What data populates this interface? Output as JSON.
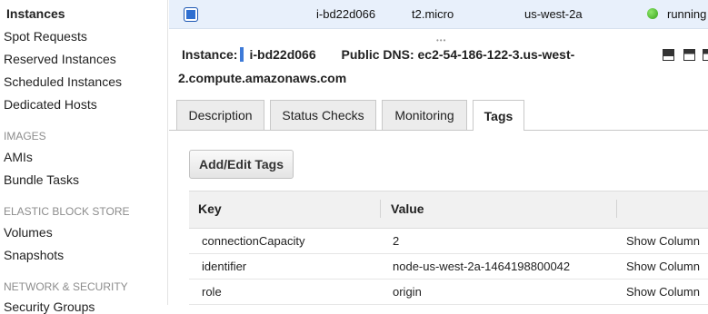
{
  "sidebar": {
    "items": [
      {
        "label": "Instances",
        "active": true
      },
      {
        "label": "Spot Requests"
      },
      {
        "label": "Reserved Instances"
      },
      {
        "label": "Scheduled Instances"
      },
      {
        "label": "Dedicated Hosts"
      }
    ],
    "images_section": "IMAGES",
    "images_items": [
      "AMIs",
      "Bundle Tasks"
    ],
    "ebs_section": "ELASTIC BLOCK STORE",
    "ebs_items": [
      "Volumes",
      "Snapshots"
    ],
    "network_section": "NETWORK & SECURITY",
    "network_items": [
      "Security Groups"
    ]
  },
  "instance_row": {
    "instance_id": "i-bd22d066",
    "instance_type": "t2.micro",
    "availability_zone": "us-west-2a",
    "state": "running",
    "state_color": "#36a31b",
    "selected": true
  },
  "detail": {
    "instance_label": "Instance:",
    "instance_id": "i-bd22d066",
    "dns_label": "Public DNS:",
    "dns_part1": "ec2-54-186-122-3.us-west-",
    "dns_part2": "2.compute.amazonaws.com",
    "panel_icons": [
      "panel-bottom-icon",
      "panel-split-icon",
      "panel-top-icon"
    ]
  },
  "tabs": [
    {
      "label": "Description",
      "active": false
    },
    {
      "label": "Status Checks",
      "active": false
    },
    {
      "label": "Monitoring",
      "active": false
    },
    {
      "label": "Tags",
      "active": true
    }
  ],
  "add_edit_button": "Add/Edit Tags",
  "tags_table": {
    "headers": [
      "Key",
      "Value"
    ],
    "rows": [
      {
        "key": "connectionCapacity",
        "value": "2",
        "action": "Show Column"
      },
      {
        "key": "identifier",
        "value": "node-us-west-2a-1464198800042",
        "action": "Show Column"
      },
      {
        "key": "role",
        "value": "origin",
        "action": "Show Column"
      }
    ]
  },
  "colors": {
    "accent": "#2f6fd1",
    "selected_row": "#e8f0fb",
    "tab_inactive": "#ececec"
  }
}
